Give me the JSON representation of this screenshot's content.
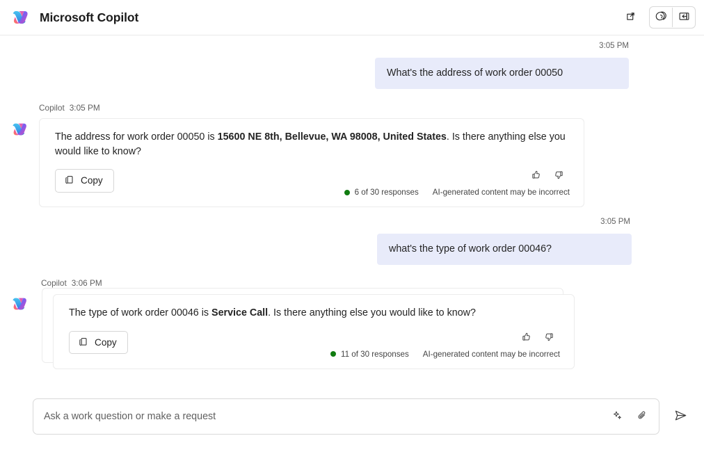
{
  "header": {
    "title": "Microsoft Copilot",
    "logo_icon": "copilot-logo-icon",
    "actions": [
      {
        "name": "open-in-new-window-button",
        "icon": "open-in-new-icon"
      },
      {
        "name": "copilot-pages-button",
        "icon": "copilot-pages-icon"
      },
      {
        "name": "collapse-panel-button",
        "icon": "panel-collapse-icon"
      }
    ]
  },
  "conversation": {
    "turns": [
      {
        "role": "user",
        "time": "3:05 PM",
        "text": "What's the address of work order 00050"
      },
      {
        "role": "bot",
        "author": "Copilot",
        "time": "3:05 PM",
        "text_before": "The address for work order 00050 is ",
        "text_bold": "15600 NE 8th, Bellevue, WA 98008, United States",
        "text_after": ". Is there anything else you would like to know?",
        "copy_label": "Copy",
        "copy_icon": "copy-icon",
        "thumbs_up_icon": "thumbs-up-icon",
        "thumbs_down_icon": "thumbs-down-icon",
        "responses_count": "6 of 30 responses",
        "disclaimer": "AI-generated content may be incorrect"
      },
      {
        "role": "user",
        "time": "3:05 PM",
        "text": "what's the type of work order 00046?"
      },
      {
        "role": "bot",
        "author": "Copilot",
        "time": "3:06 PM",
        "text_before": "The type of work order 00046 is ",
        "text_bold": "Service Call",
        "text_after": ". Is there anything else you would like to know?",
        "copy_label": "Copy",
        "copy_icon": "copy-icon",
        "thumbs_up_icon": "thumbs-up-icon",
        "thumbs_down_icon": "thumbs-down-icon",
        "responses_count": "11 of 30 responses",
        "disclaimer": "AI-generated content may be incorrect"
      }
    ]
  },
  "composer": {
    "placeholder": "Ask a work question or make a request",
    "value": "",
    "prompt_icon": "sparkle-icon",
    "attach_icon": "paperclip-icon",
    "send_icon": "send-icon"
  },
  "colors": {
    "user_bubble": "#e8ebfa",
    "status_dot": "#107c10",
    "card_border": "#ececec",
    "header_border": "#e8e8e8"
  }
}
